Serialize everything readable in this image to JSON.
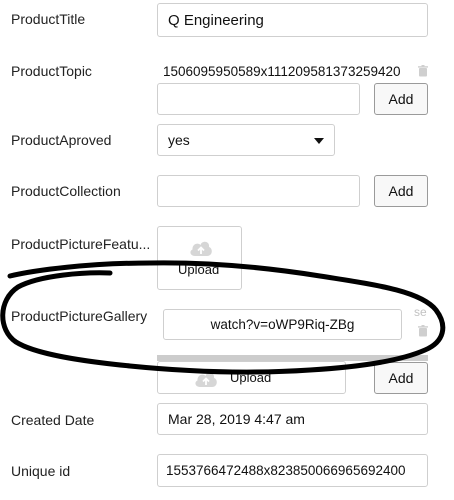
{
  "fields": {
    "product_title": {
      "label": "ProductTitle",
      "value": "Q Engineering"
    },
    "product_topic": {
      "label": "ProductTopic",
      "value": "1506095950589x111209581373259420",
      "add_input_value": "",
      "add_label": "Add"
    },
    "product_aproved": {
      "label": "ProductAproved",
      "value": "yes"
    },
    "product_collection": {
      "label": "ProductCollection",
      "value": "",
      "add_label": "Add"
    },
    "product_picture_featured": {
      "label": "ProductPictureFeatu...",
      "upload_label": "Upload"
    },
    "product_picture_gallery": {
      "label": "ProductPictureGallery",
      "value": "watch?v=oWP9Riq-ZBg",
      "side_text": "se",
      "upload_label": "Upload",
      "add_label": "Add"
    },
    "created_date": {
      "label": "Created Date",
      "value": "Mar 28, 2019 4:47 am"
    },
    "unique_id": {
      "label": "Unique id",
      "value": "1553766472488x823850066965692400"
    }
  },
  "annotation": {
    "color": "#000000",
    "shape": "hand-drawn loop"
  },
  "icons": {
    "trash": "trash-icon",
    "dropdown": "caret-down-icon",
    "upload": "cloud-upload-icon"
  }
}
